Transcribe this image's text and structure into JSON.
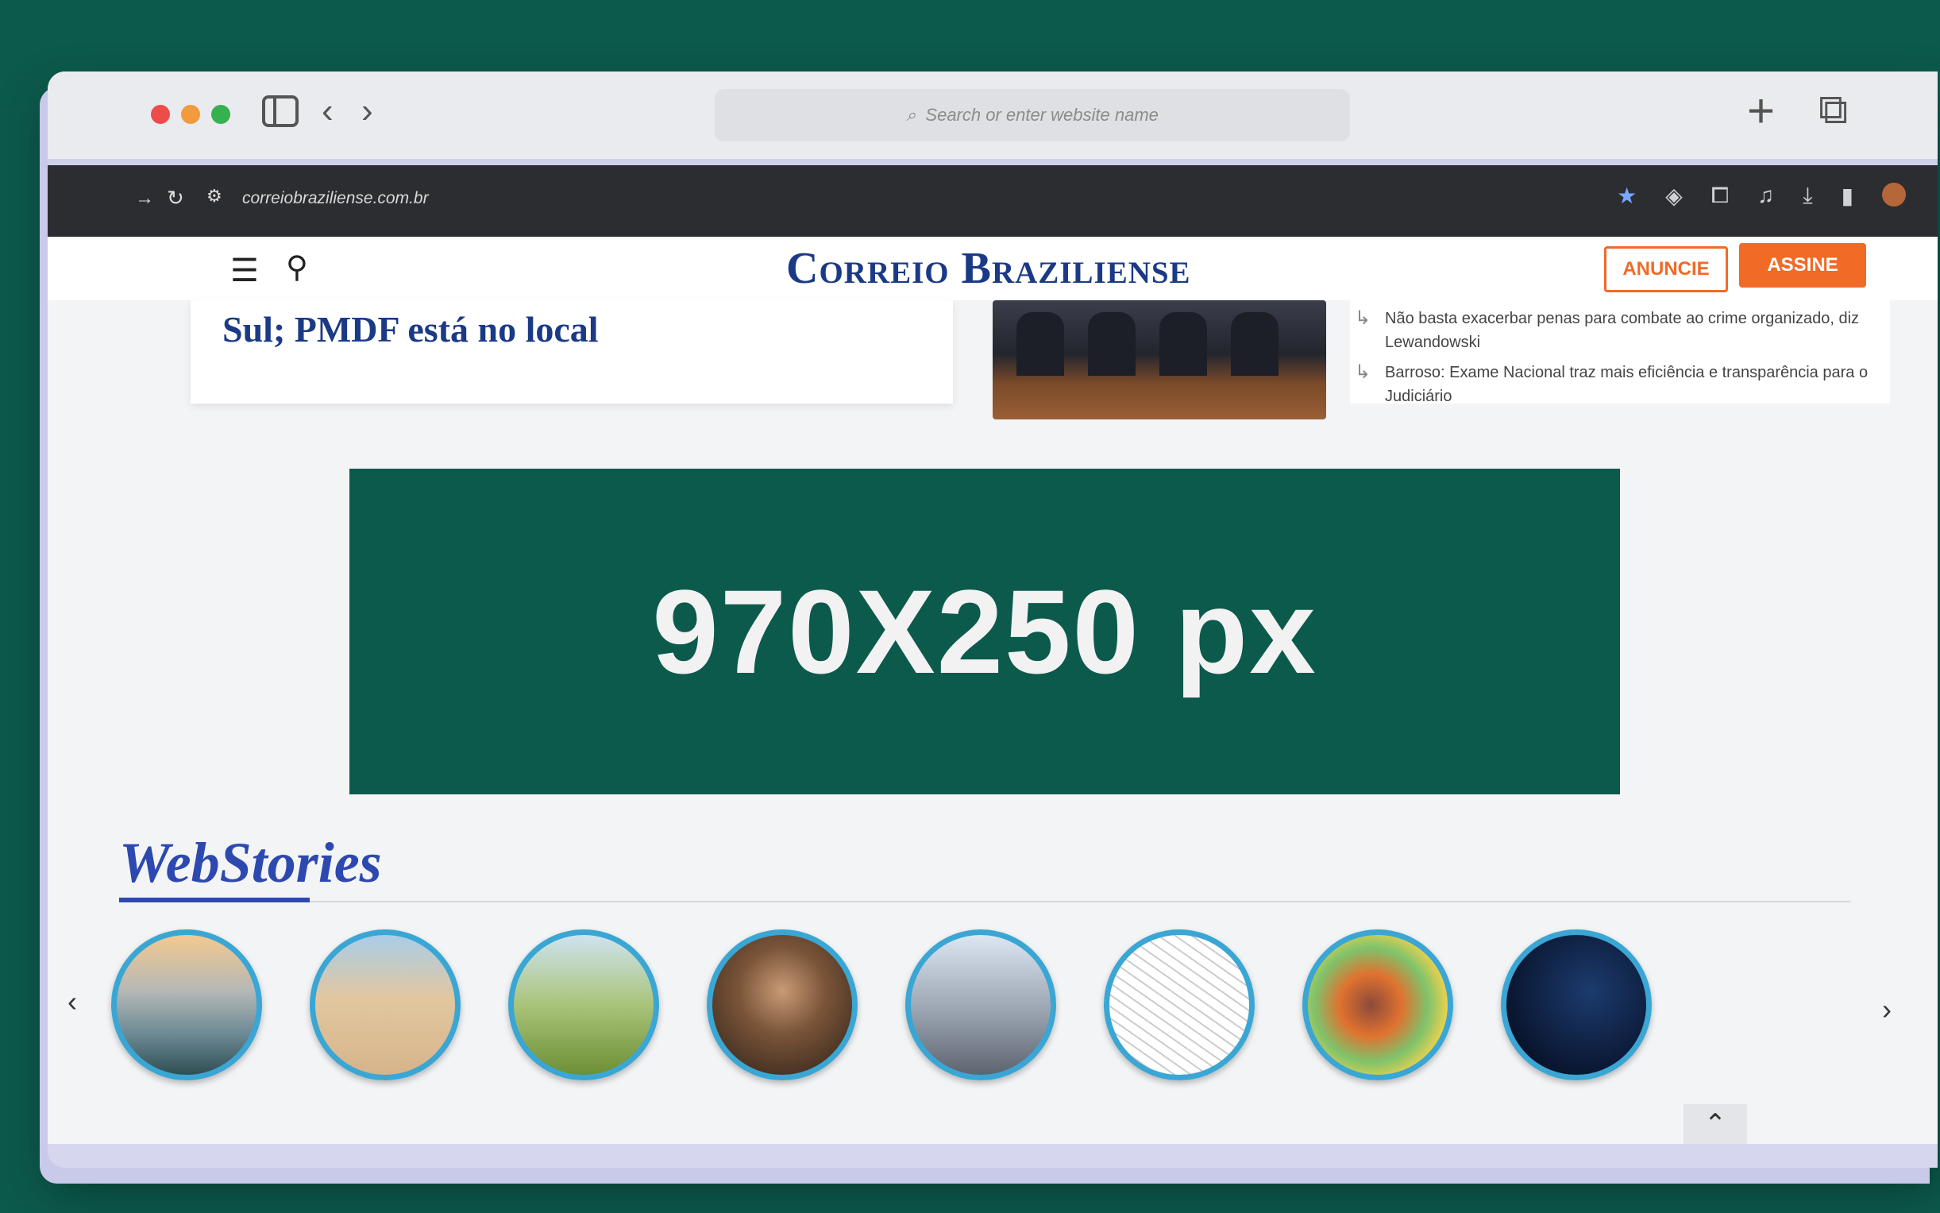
{
  "browser": {
    "search_placeholder": "Search or enter website name",
    "url": "correiobraziliense.com.br",
    "new_tab_glyph": "+",
    "tabs_glyph": "⧉"
  },
  "site": {
    "logo": "Correio Braziliense",
    "anuncie_label": "ANUNCIE",
    "assine_label": "ASSINE"
  },
  "news": {
    "headline": "Sul; PMDF está no local",
    "related": [
      "Não basta exacerbar penas para combate ao crime organizado, diz Lewandowski",
      "Barroso: Exame Nacional traz mais eficiência e transparência para o Judiciário"
    ]
  },
  "ad": {
    "label": "970X250 px"
  },
  "webstories": {
    "title": "WebStories",
    "prev_glyph": "‹",
    "next_glyph": "›"
  },
  "colors": {
    "background": "#0c5a4c",
    "brand_blue": "#1b3a86",
    "accent_orange": "#f16a26",
    "story_ring": "#3aa6d4"
  }
}
